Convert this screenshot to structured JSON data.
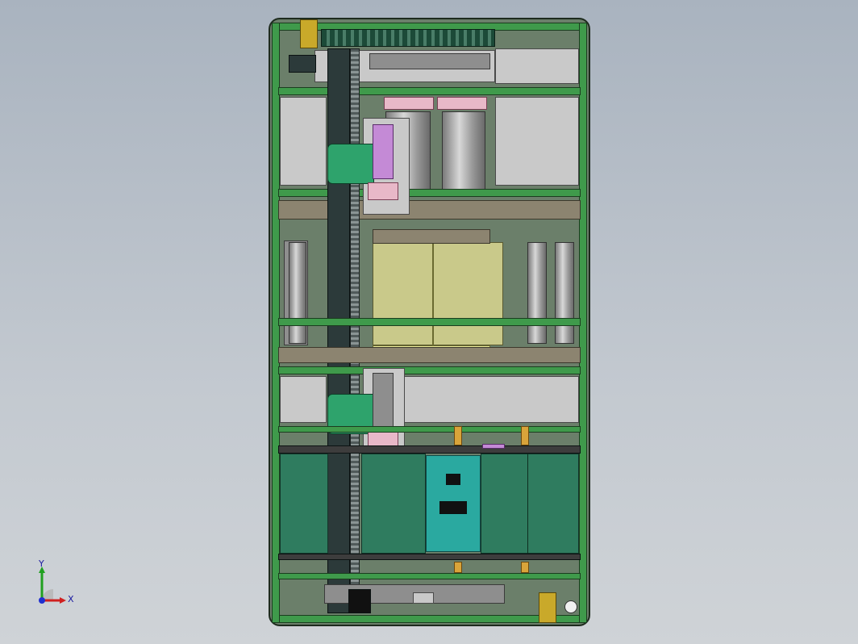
{
  "viewport": {
    "background_top": "#a9b3bf",
    "background_bottom": "#cfd3d7"
  },
  "triad": {
    "x_label": "X",
    "y_label": "Y",
    "x_color": "#d02020",
    "y_color": "#20a020",
    "z_color": "#2030d0"
  },
  "colors": {
    "frame": "#3f9a4b",
    "panel": "#2f7c5f",
    "module": "#2aa9a0",
    "carriage": "#2ea36c",
    "tray": "#c9c98a"
  }
}
